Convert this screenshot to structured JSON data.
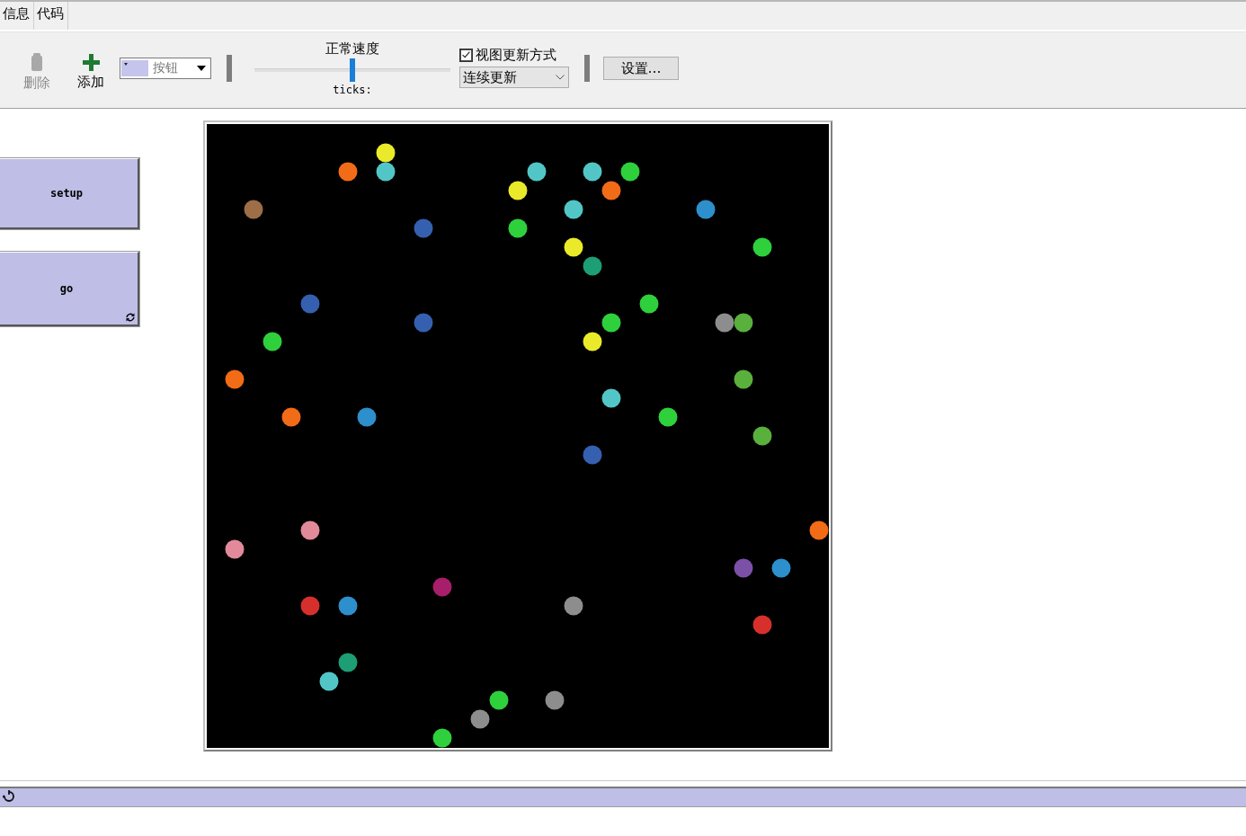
{
  "tabs": [
    {
      "label": "信息",
      "selected": false
    },
    {
      "label": "代码",
      "selected": false
    }
  ],
  "toolbar": {
    "delete": {
      "label": "删除",
      "disabled": true
    },
    "add": {
      "label": "添加",
      "disabled": false
    },
    "widget_type": {
      "value": "按钮"
    },
    "speed": {
      "label": "正常速度",
      "level": 0.5
    },
    "ticks_label": "ticks:",
    "view_updates": {
      "label": "视图更新方式",
      "checked": true
    },
    "update_mode": {
      "value": "连续更新"
    },
    "settings": {
      "label": "设置…"
    }
  },
  "buttons": [
    {
      "label": "setup",
      "forever": false
    },
    {
      "label": "go",
      "forever": true
    }
  ]
}
